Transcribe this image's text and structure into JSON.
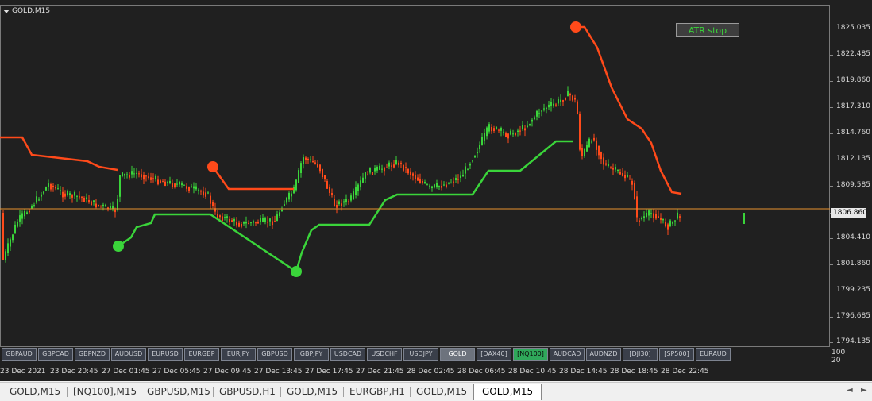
{
  "chart": {
    "title": "GOLD,M15",
    "indicator_label": "ATR stop",
    "current_price": "1806.860",
    "colors": {
      "background": "#202020",
      "bull_candle": "#3ad43a",
      "bear_candle": "#ff4a1a",
      "support_line": "#3ad43a",
      "resistance_line": "#ff4a1a",
      "price_line": "#e8922e"
    }
  },
  "price_axis": {
    "labels": [
      "1825.035",
      "1822.485",
      "1819.860",
      "1817.310",
      "1814.760",
      "1812.135",
      "1809.585",
      "1806.860",
      "1804.410",
      "1801.860",
      "1799.235",
      "1796.685",
      "1794.135"
    ]
  },
  "time_axis": {
    "labels": [
      "23 Dec 2021",
      "23 Dec 20:45",
      "27 Dec 01:45",
      "27 Dec 05:45",
      "27 Dec 09:45",
      "27 Dec 13:45",
      "27 Dec 17:45",
      "27 Dec 21:45",
      "28 Dec 02:45",
      "28 Dec 06:45",
      "28 Dec 10:45",
      "28 Dec 14:45",
      "28 Dec 18:45",
      "28 Dec 22:45"
    ]
  },
  "volume_scale": {
    "top": "100",
    "bottom": "20"
  },
  "symbol_buttons": [
    {
      "label": "GBPAUD",
      "state": "normal"
    },
    {
      "label": "GBPCAD",
      "state": "normal"
    },
    {
      "label": "GBPNZD",
      "state": "normal"
    },
    {
      "label": "AUDUSD",
      "state": "normal"
    },
    {
      "label": "EURUSD",
      "state": "normal"
    },
    {
      "label": "EURGBP",
      "state": "normal"
    },
    {
      "label": "EURJPY",
      "state": "normal"
    },
    {
      "label": "GBPUSD",
      "state": "normal"
    },
    {
      "label": "GBPJPY",
      "state": "normal"
    },
    {
      "label": "USDCAD",
      "state": "normal"
    },
    {
      "label": "USDCHF",
      "state": "normal"
    },
    {
      "label": "USDJPY",
      "state": "normal"
    },
    {
      "label": "GOLD",
      "state": "active-gray"
    },
    {
      "label": "[DAX40]",
      "state": "normal"
    },
    {
      "label": "[NQ100]",
      "state": "active-green"
    },
    {
      "label": "AUDCAD",
      "state": "normal"
    },
    {
      "label": "AUDNZD",
      "state": "normal"
    },
    {
      "label": "[DJI30]",
      "state": "normal"
    },
    {
      "label": "[SP500]",
      "state": "normal"
    },
    {
      "label": "EURAUD",
      "state": "normal"
    }
  ],
  "tabs": [
    {
      "label": "GOLD,M15",
      "active": false
    },
    {
      "label": "[NQ100],M15",
      "active": false
    },
    {
      "label": "GBPUSD,M15",
      "active": false
    },
    {
      "label": "GBPUSD,H1",
      "active": false
    },
    {
      "label": "GOLD,M15",
      "active": false
    },
    {
      "label": "EURGBP,H1",
      "active": false
    },
    {
      "label": "GOLD,M15",
      "active": false
    },
    {
      "label": "GOLD,M15",
      "active": true
    }
  ],
  "scroll": {
    "left": "◄",
    "right": "►"
  }
}
